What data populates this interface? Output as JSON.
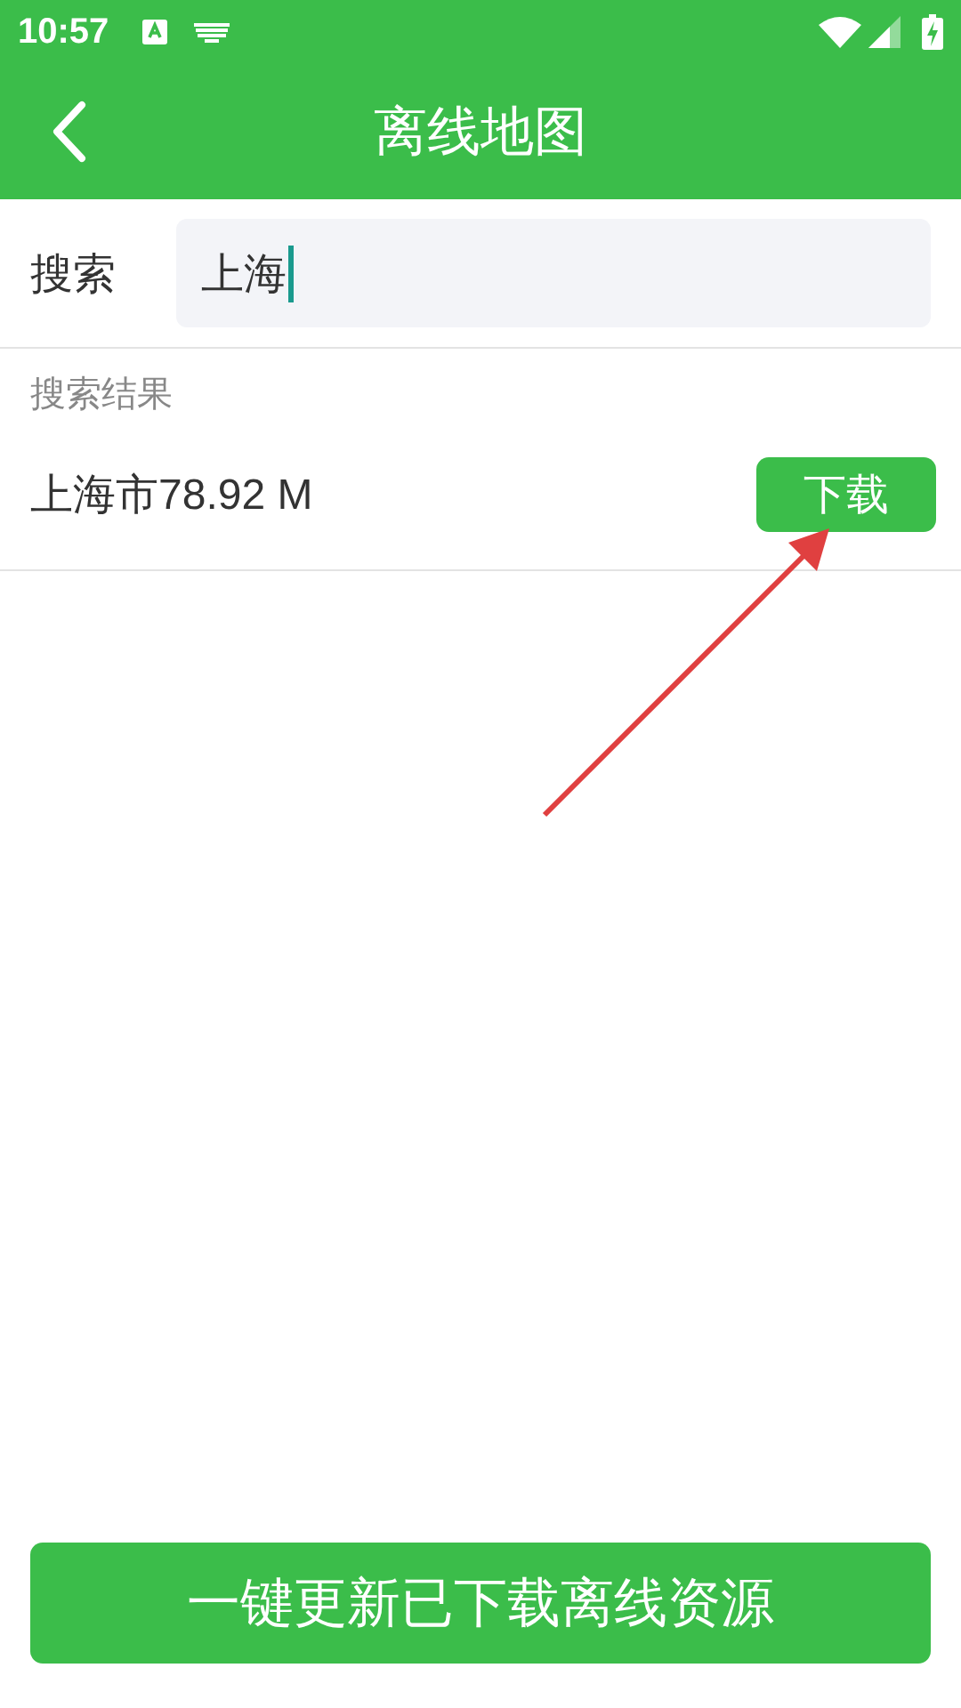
{
  "status_bar": {
    "time": "10:57"
  },
  "app_bar": {
    "title": "离线地图"
  },
  "search": {
    "label": "搜索",
    "value": "上海"
  },
  "results": {
    "heading": "搜索结果",
    "items": [
      {
        "name": "上海市78.92 M",
        "action": "下载"
      }
    ]
  },
  "bottom_button": "一键更新已下载离线资源"
}
